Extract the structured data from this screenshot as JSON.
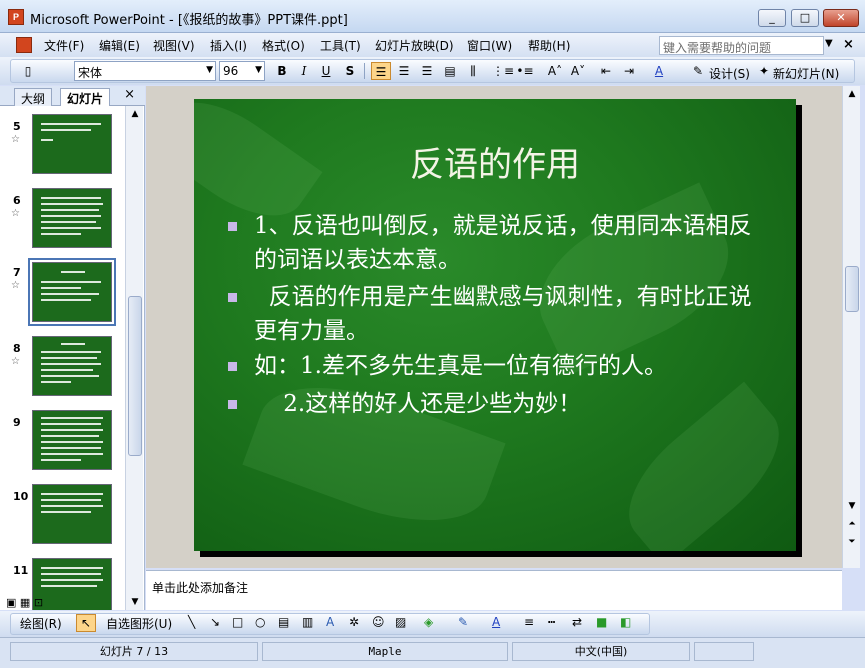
{
  "window": {
    "title": "Microsoft PowerPoint - [《报纸的故事》PPT课件.ppt]"
  },
  "menu": {
    "items": [
      "文件(F)",
      "编辑(E)",
      "视图(V)",
      "插入(I)",
      "格式(O)",
      "工具(T)",
      "幻灯片放映(D)",
      "窗口(W)",
      "帮助(H)"
    ],
    "help_placeholder": "键入需要帮助的问题"
  },
  "toolbar": {
    "font_name": "宋体",
    "font_size": "96",
    "bold": "B",
    "italic": "I",
    "underline": "U",
    "shadow": "S",
    "design_label": "设计(S)",
    "new_slide_label": "新幻灯片(N)"
  },
  "left_pane": {
    "tabs": [
      "大纲",
      "幻灯片"
    ],
    "close_glyph": "×",
    "slide_numbers": [
      "5",
      "6",
      "7",
      "8",
      "9",
      "10",
      "11"
    ],
    "selected_slide": "7"
  },
  "slide": {
    "title": "反语的作用",
    "bullets": [
      "1、反语也叫倒反，就是说反话，使用同本语相反的词语以表达本意。",
      "  反语的作用是产生幽默感与讽刺性，有时比正说更有力量。",
      "如：1.差不多先生真是一位有德行的人。",
      "    2.这样的好人还是少些为妙！"
    ]
  },
  "notes": {
    "placeholder": "单击此处添加备注"
  },
  "drawing_toolbar": {
    "draw_label": "绘图(R)",
    "autoshapes_label": "自选图形(U)"
  },
  "status": {
    "slide_indicator": "幻灯片 7 / 13",
    "theme": "Maple",
    "language": "中文(中国)"
  }
}
